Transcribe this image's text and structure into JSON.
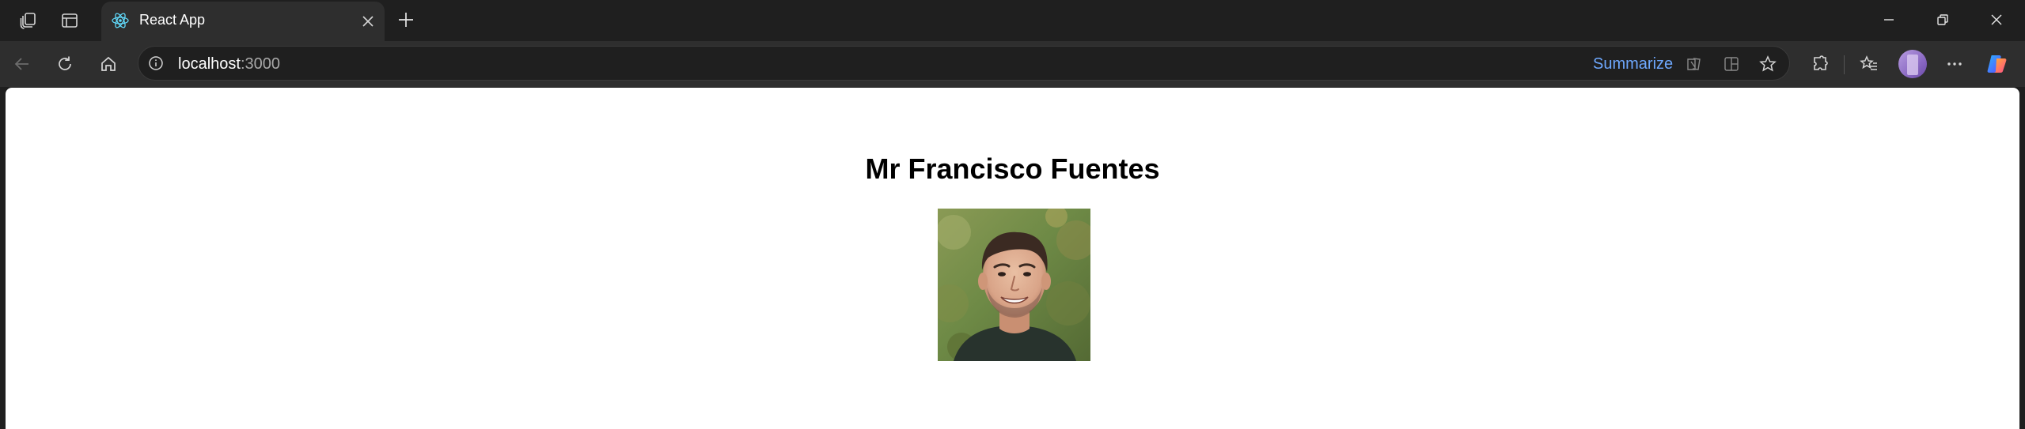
{
  "browser": {
    "tab": {
      "title": "React App",
      "favicon": "react-logo-icon"
    },
    "address_bar": {
      "host": "localhost",
      "port": ":3000",
      "summarize_label": "Summarize"
    },
    "icons": {
      "workspaces": "workspaces-icon",
      "vertical_tabs": "tab-actions-icon",
      "close_tab": "close-icon",
      "new_tab": "plus-icon",
      "back": "back-arrow-icon",
      "refresh": "refresh-icon",
      "home": "home-icon",
      "site_info": "info-icon",
      "read_aloud": "immersive-reader-icon",
      "split_screen": "split-screen-icon",
      "favorite": "star-icon",
      "extensions": "puzzle-icon",
      "favorites": "favorites-icon",
      "profile": "avatar",
      "more": "more-icon",
      "copilot": "copilot-icon",
      "minimize": "minimize-icon",
      "restore": "restore-icon",
      "close_window": "close-icon"
    },
    "colors": {
      "chrome_dark": "#1f1f1f",
      "toolbar": "#2e2e2e",
      "summarize_link": "#6ea8fe",
      "page_background": "#ffffff"
    }
  },
  "page": {
    "heading": "Mr Francisco Fuentes",
    "photo": {
      "alt": "profile photo",
      "description_icon": "person-photo"
    }
  }
}
